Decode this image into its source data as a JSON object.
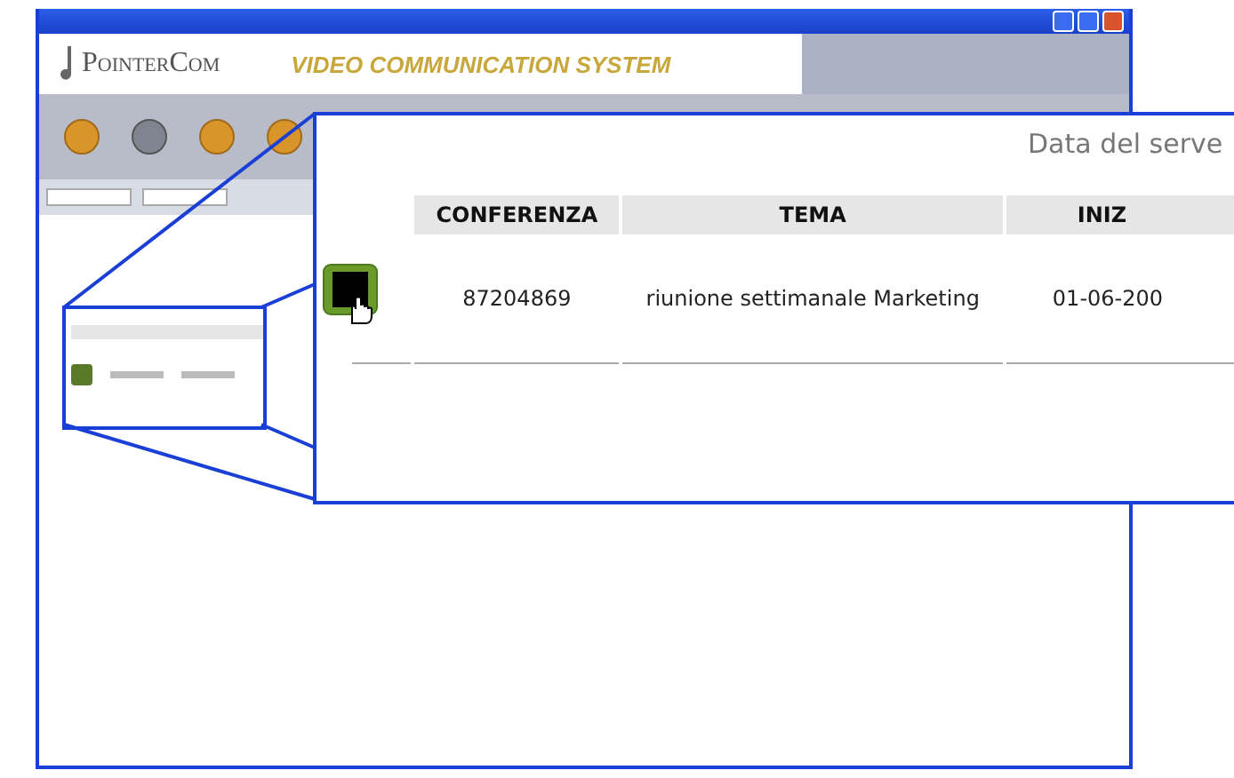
{
  "window": {
    "app_name": "PointerCom",
    "tagline": "VIDEO COMMUNICATION SYSTEM"
  },
  "zoom_panel": {
    "server_date_label": "Data del serve",
    "columns": [
      "CONFERENZA",
      "TEMA",
      "INIZ"
    ],
    "rows": [
      {
        "conferenza": "87204869",
        "tema": "riunione settimanale Marketing",
        "inizio": "01-06-200"
      }
    ]
  }
}
